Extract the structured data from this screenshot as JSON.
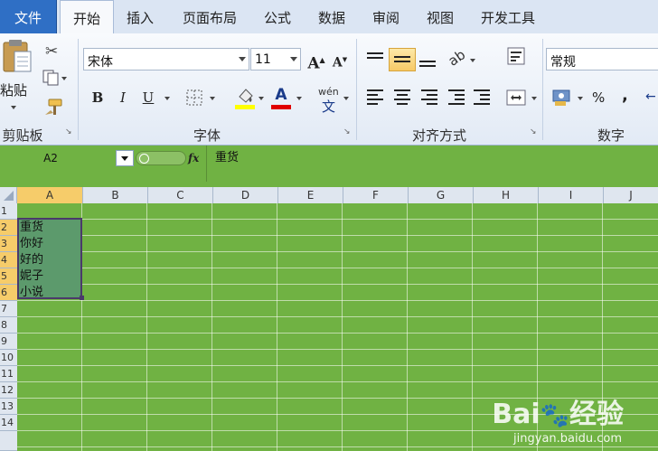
{
  "ribbon_tabs": [
    "文件",
    "开始",
    "插入",
    "页面布局",
    "公式",
    "数据",
    "审阅",
    "视图",
    "开发工具"
  ],
  "clipboard": {
    "paste_label": "粘贴",
    "group_label": "剪贴板"
  },
  "font": {
    "name": "宋体",
    "size": "11",
    "group_label": "字体",
    "wen": "wén",
    "font_color": "#e00000",
    "fill_color": "#ffff00"
  },
  "alignment": {
    "group_label": "对齐方式"
  },
  "number": {
    "format": "常规",
    "group_label": "数字",
    "percent": "%",
    "comma": ","
  },
  "formula_bar": {
    "name_box": "A2",
    "fx": "fx",
    "content": "重货"
  },
  "columns": [
    "A",
    "B",
    "C",
    "D",
    "E",
    "F",
    "G",
    "H",
    "I",
    "J"
  ],
  "rows": [
    "1",
    "2",
    "3",
    "4",
    "5",
    "6",
    "7",
    "8",
    "9",
    "10",
    "11",
    "12",
    "13",
    "14"
  ],
  "cells_a": [
    "",
    "重货",
    "你好",
    "好的",
    "妮子",
    "小说"
  ],
  "watermark": {
    "brand": "Bai",
    "brand2": "经验",
    "url": "jingyan.baidu.com"
  }
}
